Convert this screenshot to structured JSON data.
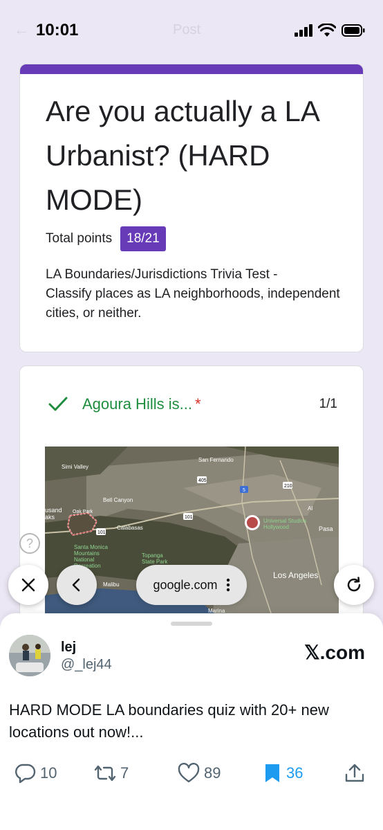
{
  "status_bar": {
    "time": "10:01",
    "ghost_title": "Post"
  },
  "form": {
    "title": "Are you actually a LA Urbanist? (HARD MODE)",
    "points_label": "Total points",
    "points_value": "18/21",
    "description": "LA Boundaries/Jurisdictions Trivia Test -\n Classify places as LA neighborhoods, independent cities, or neither.",
    "accent_color": "#673ab7"
  },
  "question": {
    "text": "Agoura Hills is...",
    "required_mark": "*",
    "score": "1/1",
    "correct_color": "#1e8e3e",
    "map_labels": {
      "simi_valley": "Simi Valley",
      "san_fernando": "San Fernando",
      "bell_canyon": "Bell Canyon",
      "thousand_oaks": "usand\naks",
      "oak_park": "Oak Park",
      "calabasas": "Calabasas",
      "santa_monica_mountains": "Santa Monica\nMountains\nNational\nRecreation",
      "topanga": "Topanga\nState Park",
      "universal": "Universal Studios\nHollywood",
      "los_angeles": "Los Angeles",
      "malibu": "Malibu",
      "marina": "Marina",
      "pasadena": "Pasa",
      "al": "Al",
      "hwy_101a": "101",
      "hwy_101b": "101",
      "hwy_405": "405",
      "hwy_5": "5",
      "hwy_210": "210"
    }
  },
  "browser": {
    "url": "google.com"
  },
  "post": {
    "user_name": "lej",
    "user_handle": "@_lej44",
    "site": "𝕏.com",
    "text": "HARD MODE LA boundaries quiz with 20+ new locations out now!...",
    "replies": "10",
    "reposts": "7",
    "likes": "89",
    "bookmarks": "36",
    "bookmark_color": "#1d9bf0"
  }
}
